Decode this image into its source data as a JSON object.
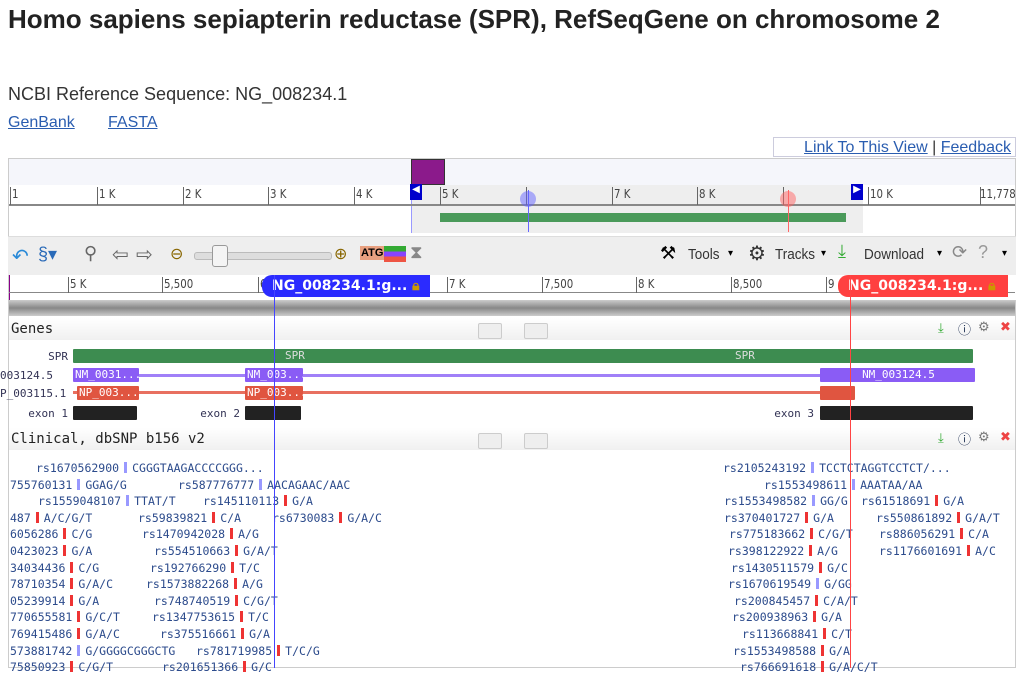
{
  "title": "Homo sapiens sepiapterin reductase (SPR), RefSeqGene on chromosome 2",
  "subtitle": "NCBI Reference Sequence: NG_008234.1",
  "links": [
    "GenBank",
    "FASTA"
  ],
  "top_links": {
    "link_view": "Link To This View",
    "sep": "|",
    "feedback": "Feedback"
  },
  "overview_ticks": [
    "1",
    "1 K",
    "2 K",
    "3 K",
    "4 K",
    "5 K",
    "6 K",
    "7 K",
    "8 K",
    "9 K",
    "10 K",
    "11,778"
  ],
  "toolbar": {
    "tools": "Tools",
    "tracks": "Tracks",
    "download": "Download",
    "zoom_slider_level": 0.2
  },
  "detail_ticks": [
    "5 K",
    "5,500",
    "6",
    "7 K",
    "7,500",
    "8 K",
    "8,500",
    "9"
  ],
  "markers": {
    "blue": "NG_008234.1:g...",
    "red": "NG_008234.1:g..."
  },
  "genes_track": {
    "title": "Genes",
    "gene": "SPR",
    "gene_label_2": "SPR",
    "rna_label": "003124.5",
    "rna_bars": [
      "NM_0031...",
      "NM_003...",
      "NM_003124.5"
    ],
    "protein_label": "P_003115.1",
    "protein_bars": [
      "NP_003...",
      "NP_003..."
    ],
    "exons": [
      "exon 1",
      "exon 2",
      "exon 3"
    ]
  },
  "snp_track": {
    "title": "Clinical, dbSNP b156 v2",
    "entries": [
      {
        "id": "rs1670562900",
        "allele": "CGGGTAAGACCCCGGG...",
        "mark": "blue"
      },
      {
        "id": "755760131",
        "allele": "GGAG/G",
        "mark": "blue"
      },
      {
        "id": "rs587776777",
        "allele": "AACAGAAC/AAC",
        "mark": "blue"
      },
      {
        "id": "rs1559048107",
        "allele": "TTAT/T",
        "mark": "blue"
      },
      {
        "id": "rs145110113",
        "allele": "G/A",
        "mark": "red"
      },
      {
        "id": "487",
        "allele": "A/C/G/T",
        "mark": "red"
      },
      {
        "id": "rs59839821",
        "allele": "C/A",
        "mark": "red"
      },
      {
        "id": "rs6730083",
        "allele": "G/A/C",
        "mark": "red"
      },
      {
        "id": "6056286",
        "allele": "C/G",
        "mark": "red"
      },
      {
        "id": "rs1470942028",
        "allele": "A/G",
        "mark": "red"
      },
      {
        "id": "0423023",
        "allele": "G/A",
        "mark": "red"
      },
      {
        "id": "rs554510663",
        "allele": "G/A/T",
        "mark": "red"
      },
      {
        "id": "34034436",
        "allele": "C/G",
        "mark": "red"
      },
      {
        "id": "rs192766290",
        "allele": "T/C",
        "mark": "red"
      },
      {
        "id": "78710354",
        "allele": "G/A/C",
        "mark": "red"
      },
      {
        "id": "rs1573882268",
        "allele": "A/G",
        "mark": "red"
      },
      {
        "id": "05239914",
        "allele": "G/A",
        "mark": "red"
      },
      {
        "id": "rs748740519",
        "allele": "C/G/T",
        "mark": "red"
      },
      {
        "id": "770655581",
        "allele": "G/C/T",
        "mark": "red"
      },
      {
        "id": "rs1347753615",
        "allele": "T/C",
        "mark": "red"
      },
      {
        "id": "769415486",
        "allele": "G/A/C",
        "mark": "red"
      },
      {
        "id": "rs375516661",
        "allele": "G/A",
        "mark": "red"
      },
      {
        "id": "573881742",
        "allele": "G/GGGGCGGGCTG",
        "mark": "blue"
      },
      {
        "id": "rs781719985",
        "allele": "T/C/G",
        "mark": "red"
      },
      {
        "id": "75850923",
        "allele": "C/G/T",
        "mark": "red"
      },
      {
        "id": "rs201651366",
        "allele": "G/C",
        "mark": "red"
      },
      {
        "id": "rs2105243192",
        "allele": "TCCTCTAGGTCCTCT/...",
        "mark": "blue"
      },
      {
        "id": "rs1553498611",
        "allele": "AAATAA/AA",
        "mark": "blue"
      },
      {
        "id": "rs1553498582",
        "allele": "GG/G",
        "mark": "blue"
      },
      {
        "id": "rs61518691",
        "allele": "G/A",
        "mark": "red"
      },
      {
        "id": "rs370401727",
        "allele": "G/A",
        "mark": "red"
      },
      {
        "id": "rs550861892",
        "allele": "G/A/T",
        "mark": "red"
      },
      {
        "id": "rs775183662",
        "allele": "C/G/T",
        "mark": "red"
      },
      {
        "id": "rs886056291",
        "allele": "C/A",
        "mark": "red"
      },
      {
        "id": "rs398122922",
        "allele": "A/G",
        "mark": "red"
      },
      {
        "id": "rs1176601691",
        "allele": "A/C",
        "mark": "red"
      },
      {
        "id": "rs1430511579",
        "allele": "G/C",
        "mark": "red"
      },
      {
        "id": "rs1670619549",
        "allele": "G/GG",
        "mark": "blue"
      },
      {
        "id": "rs200845457",
        "allele": "C/A/T",
        "mark": "red"
      },
      {
        "id": "rs200938963",
        "allele": "G/A",
        "mark": "red"
      },
      {
        "id": "rs113668841",
        "allele": "C/T",
        "mark": "red"
      },
      {
        "id": "rs1553498588",
        "allele": "G/A",
        "mark": "red"
      },
      {
        "id": "rs766691618",
        "allele": "G/A/C/T",
        "mark": "red"
      }
    ]
  },
  "colors": {
    "gene": "#3d8c50",
    "rna": "#8a5cf5",
    "protein": "#e05540",
    "exon": "#222222",
    "blue_marker": "#3333ff",
    "red_marker": "#ff4444",
    "overview_block": "#8b1a8b"
  }
}
